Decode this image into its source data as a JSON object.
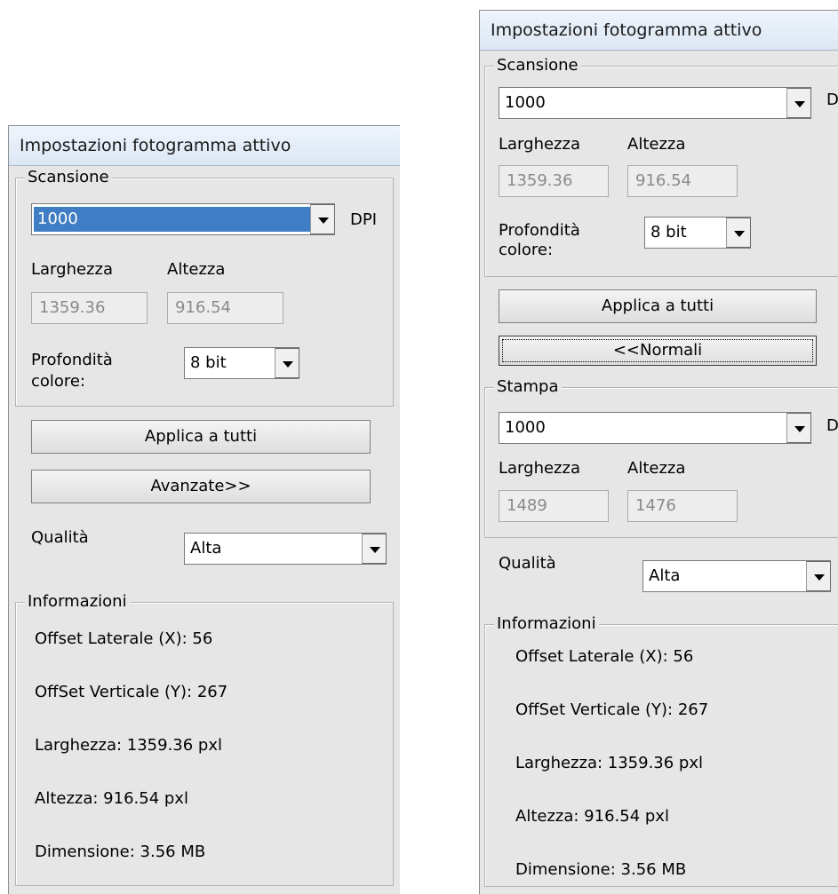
{
  "left_panel": {
    "title": "Impostazioni fotogramma attivo",
    "scan": {
      "legend": "Scansione",
      "dpi_value": "1000",
      "dpi_unit": "DPI",
      "width_label": "Larghezza",
      "height_label": "Altezza",
      "width_value": "1359.36",
      "height_value": "916.54",
      "depth_label_line1": "Profondità",
      "depth_label_line2": "colore:",
      "depth_value": "8 bit"
    },
    "apply_all_label": "Applica a tutti",
    "advanced_label": "Avanzate>>",
    "quality_label": "Qualità",
    "quality_value": "Alta",
    "info": {
      "legend": "Informazioni",
      "offset_x": "Offset Laterale (X): 56",
      "offset_y": "OffSet Verticale (Y): 267",
      "width": "Larghezza: 1359.36 pxl",
      "height": "Altezza: 916.54 pxl",
      "size": "Dimensione: 3.56 MB"
    }
  },
  "right_panel": {
    "title": "Impostazioni fotogramma attivo",
    "scan": {
      "legend": "Scansione",
      "dpi_value": "1000",
      "dpi_unit": "DPI",
      "width_label": "Larghezza",
      "height_label": "Altezza",
      "width_value": "1359.36",
      "height_value": "916.54",
      "depth_label_line1": "Profondità",
      "depth_label_line2": "colore:",
      "depth_value": "8 bit"
    },
    "apply_all_label": "Applica a tutti",
    "normal_label": "<<Normali",
    "print": {
      "legend": "Stampa",
      "dpi_value": "1000",
      "dpi_unit": "DPI",
      "width_label": "Larghezza",
      "height_label": "Altezza",
      "width_value": "1489",
      "height_value": "1476"
    },
    "quality_label": "Qualità",
    "quality_value": "Alta",
    "info": {
      "legend": "Informazioni",
      "offset_x": "Offset Laterale (X): 56",
      "offset_y": "OffSet Verticale (Y): 267",
      "width": "Larghezza: 1359.36 pxl",
      "height": "Altezza: 916.54 pxl",
      "size": "Dimensione: 3.56 MB"
    }
  }
}
